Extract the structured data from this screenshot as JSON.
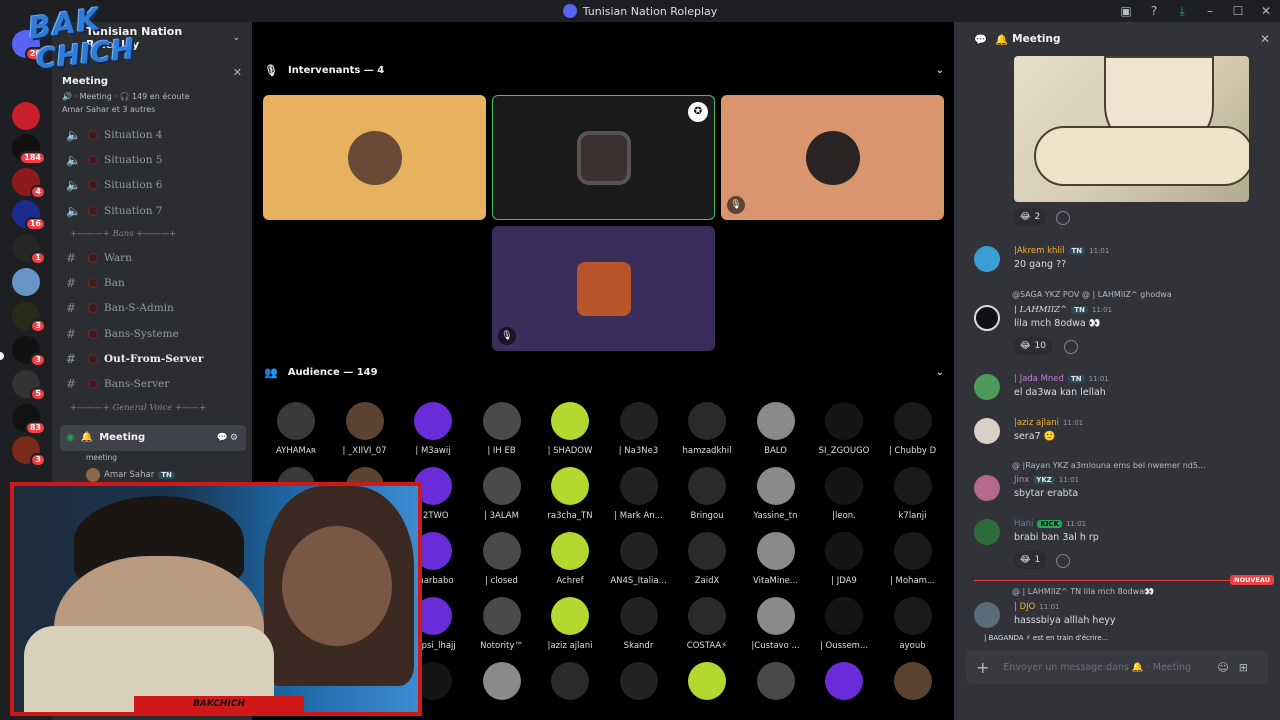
{
  "window": {
    "title": "Tunisian Nation Roleplay"
  },
  "guild": {
    "name": "Tunisian Nation Roleplay"
  },
  "overlay": {
    "logo_line1": "BAK",
    "logo_line2": "CHICH",
    "cam_label": "BAKCHICH"
  },
  "rail": {
    "badges": [
      "20",
      "184",
      "4",
      "16",
      "1",
      "3",
      "3",
      "5",
      "83",
      "3"
    ]
  },
  "ongoing_event": {
    "title": "Meeting",
    "status": "🔊 · Meeting · 🎧 149 en écoute",
    "participants": "Amar Sahar et 3 autres"
  },
  "channels": [
    {
      "name": "Situation 4",
      "type": "voice"
    },
    {
      "name": "Situation 5",
      "type": "voice"
    },
    {
      "name": "Situation 6",
      "type": "voice"
    },
    {
      "name": "Situation 7",
      "type": "voice"
    }
  ],
  "category_bans": "+———+ Bans +———+",
  "ban_channels": [
    {
      "name": "Warn",
      "bold": false
    },
    {
      "name": "Ban",
      "bold": false
    },
    {
      "name": "Ban-S-Admin",
      "bold": false
    },
    {
      "name": "Bans-Systeme",
      "bold": false
    },
    {
      "name": "Out-From-Server",
      "bold": true
    },
    {
      "name": "Bans-Server",
      "bold": false
    }
  ],
  "category_voice": "+———+ General Voice +——+",
  "active_voice": {
    "name": "Meeting",
    "topic": "meeting",
    "user": "Amar Sahar",
    "tag": "TN"
  },
  "stage": {
    "speakers_label": "Intervenants — 4",
    "audience_label": "Audience — 149",
    "speaker_colors": [
      "#e7b15f",
      "#1b1a1a",
      "#d8956e",
      "#3a2d5c"
    ]
  },
  "audience": [
    "AYHAMᴀʀ",
    "| _XIIVI_07",
    "| M3awij",
    "| IH EB",
    "| SHADOW",
    "| Na3Ne3",
    "hamzadkhil",
    "BALO",
    "SI_ZGOUGO",
    "| Chubby D",
    "",
    "",
    "| 2TWO",
    "| 3ALAM",
    "ra3cha_TN",
    "| Mark An...",
    "Bringou",
    "Yassine_tn",
    "|leon.",
    "k7lanji",
    "",
    "",
    "Charbabo",
    "| closed",
    "Achref",
    "AN4S_Italia...",
    "ZaidX",
    "VitaMine...",
    "| JDA9",
    "| Moham...",
    "",
    "",
    "|tepsi_lhajj",
    "Notority™",
    "|aziz ajlani",
    "Skandr",
    "COSTAA⚡",
    "|Custavo ...",
    "| Oussem...",
    "ayoub"
  ],
  "chat": {
    "channel": "Meeting",
    "messages": [
      {
        "author": "|Akrem khlil",
        "tag": "TN",
        "time": "11:01",
        "text": "20 gang ??",
        "color": "#f0b232"
      },
      {
        "author": "| LAHMIIZ^",
        "tag": "TN",
        "time": "11:01",
        "text": "lila mch 8odwa 👀",
        "color": "#dbdee1",
        "reply": "@SAGA  YKZ  POV @  | LAHMIIZ^  ghodwa"
      },
      {
        "author": "| Jada Mned",
        "tag": "TN",
        "time": "11:01",
        "text": "el da3wa kan lellah",
        "color": "#c27ad9"
      },
      {
        "author": "|aziz ajlani",
        "tag": "",
        "time": "11:01",
        "text": "sera7 🙂",
        "color": "#f0b232"
      },
      {
        "author": "Jinx",
        "tag": "YKZ",
        "time": "11:01",
        "text": "sbytar erabta",
        "color": "#c27ad9",
        "reply": "@  |Rayan  YKZ  a3mlouna ems bel nwemer nd5..."
      },
      {
        "author": "Hani",
        "tag": "KICK",
        "time": "11:01",
        "text": "brabi ban 3al h rp",
        "color": "#5b7fa3"
      },
      {
        "author": "| DJO",
        "tag": "",
        "time": "11:01",
        "text": "hasssbiya alllah heyy",
        "color": "#f0b232",
        "reply": "@  | LAHMIIZ^  TN  lila mch 8odwa👀"
      }
    ],
    "reactions": [
      "2",
      "10",
      "1"
    ],
    "new_label": "NOUVEAU",
    "typing": "| BAGANDA ⚡ est en train d'écrire...",
    "composer_placeholder": "Envoyer un message dans 🔔 · Meeting"
  }
}
